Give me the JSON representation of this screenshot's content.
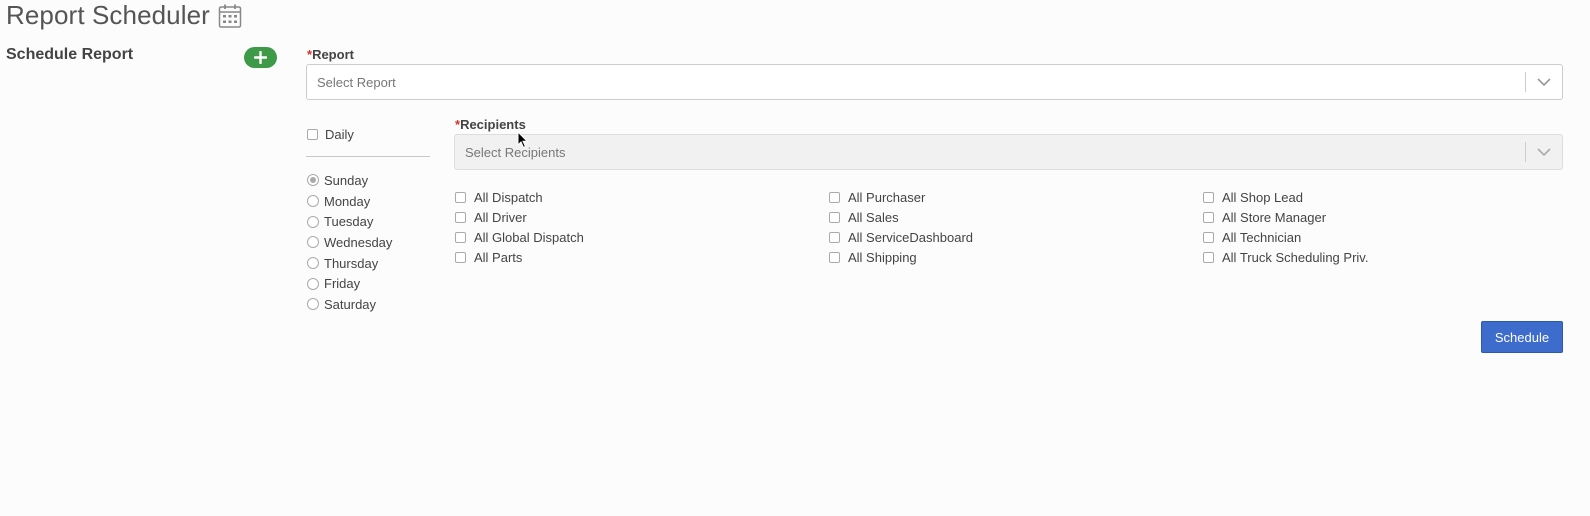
{
  "page": {
    "title": "Report Scheduler",
    "title_icon": "calendar-icon"
  },
  "schedule_section": {
    "title": "Schedule Report",
    "add_icon": "plus-icon",
    "add_button_color": "#3e9a48"
  },
  "report_field": {
    "required_mark": "*",
    "label": "Report",
    "placeholder": "Select Report"
  },
  "frequency": {
    "daily_label": "Daily",
    "daily_checked": false,
    "days": [
      {
        "label": "Sunday",
        "selected": true
      },
      {
        "label": "Monday",
        "selected": false
      },
      {
        "label": "Tuesday",
        "selected": false
      },
      {
        "label": "Wednesday",
        "selected": false
      },
      {
        "label": "Thursday",
        "selected": false
      },
      {
        "label": "Friday",
        "selected": false
      },
      {
        "label": "Saturday",
        "selected": false
      }
    ]
  },
  "recipients_field": {
    "required_mark": "*",
    "label": "Recipients",
    "placeholder": "Select Recipients",
    "disabled": true
  },
  "recipient_groups": {
    "column_1": [
      "All Dispatch",
      "All Driver",
      "All Global Dispatch",
      "All Parts"
    ],
    "column_2": [
      "All Purchaser",
      "All Sales",
      "All ServiceDashboard",
      "All Shipping"
    ],
    "column_3": [
      "All Shop Lead",
      "All Store Manager",
      "All Technician",
      "All Truck Scheduling Priv."
    ]
  },
  "actions": {
    "schedule_label": "Schedule",
    "schedule_color": "#3d6ccc"
  },
  "colors": {
    "required": "#d9302a",
    "background": "#fcfcfc"
  }
}
